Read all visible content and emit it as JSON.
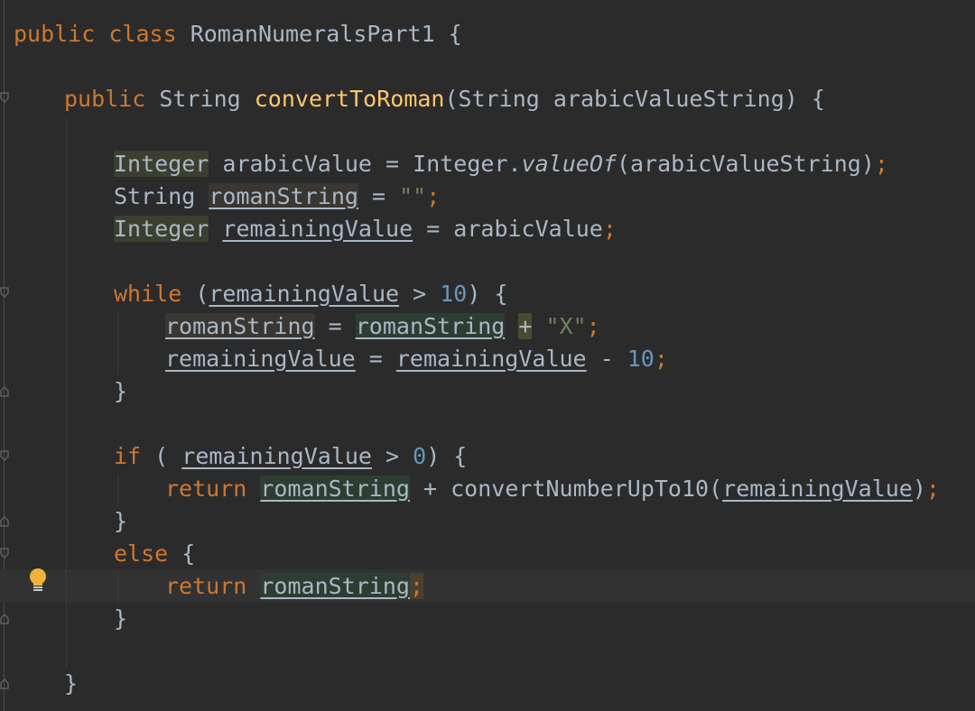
{
  "editor": {
    "lines": {
      "class_decl": {
        "kw_public": "public",
        "kw_class": "class",
        "class_name": "RomanNumeralsPart1",
        "brace": "{"
      },
      "method_decl": {
        "kw_public": "public",
        "type": "String",
        "method": "convertToRoman",
        "params": "(String arabicValueString)",
        "brace": "{"
      },
      "line_integer_arabic": {
        "type": "Integer",
        "var": "arabicValue",
        "eq": " = ",
        "call_obj": "Integer.",
        "call_fn": "valueOf",
        "call_args": "(arabicValueString)",
        "semi": ";"
      },
      "line_string_roman": {
        "type": "String",
        "var": "romanString",
        "eq": " = ",
        "literal": "\"\"",
        "semi": ";"
      },
      "line_integer_remaining": {
        "type": "Integer",
        "var": "remainingValue",
        "eq": " = ",
        "value": "arabicValue",
        "semi": ";"
      },
      "while_line": {
        "kw": "while",
        "open": " (",
        "var": "remainingValue",
        "op": " > ",
        "num": "10",
        "close": ") {"
      },
      "while_body_1": {
        "lhs": "romanString",
        "eq": " = ",
        "rhs": "romanString",
        "plus": "+",
        "literal": "\"X\"",
        "semi": ";"
      },
      "while_body_2": {
        "lhs": "remainingValue",
        "eq": " = ",
        "rhs": "remainingValue",
        "minus": " - ",
        "num": "10",
        "semi": ";"
      },
      "while_close": "}",
      "if_line": {
        "kw": "if",
        "open": " ( ",
        "var": "remainingValue",
        "op": " > ",
        "num": "0",
        "close": ") {"
      },
      "if_body": {
        "kw": "return",
        "var": "romanString",
        "plus": " + ",
        "call": "convertNumberUpTo10(",
        "arg": "remainingValue",
        "close": ")",
        "semi": ";"
      },
      "if_close": "}",
      "else_line": {
        "kw": "else",
        "brace": " {"
      },
      "else_body": {
        "kw": "return",
        "var": "romanString",
        "semi": ";"
      },
      "else_close": "}",
      "method_close": "}"
    },
    "colors": {
      "background": "#2b2b2b",
      "keyword": "#cc7832",
      "method": "#ffc66d",
      "string": "#6a8759",
      "number": "#6897bb",
      "text": "#a9b7c6",
      "intention_bulb": "#f0b33a"
    },
    "icons": [
      "fold-marker-icon",
      "lightbulb-icon"
    ]
  }
}
